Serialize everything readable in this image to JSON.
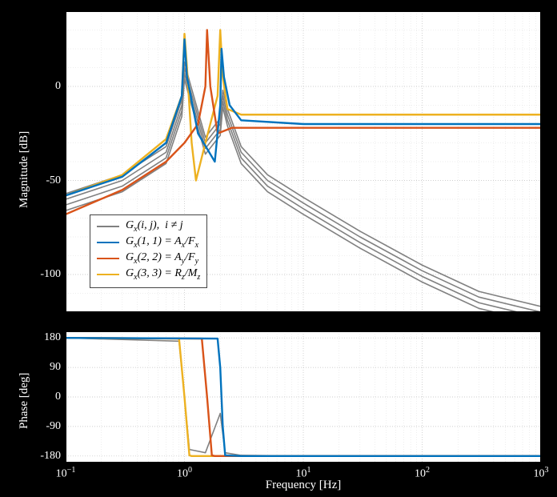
{
  "chart_data": [
    {
      "type": "line",
      "title": "",
      "xlabel": "",
      "ylabel": "Magnitude [dB]",
      "xscale": "log",
      "xlim": [
        0.1,
        1000
      ],
      "ylim": [
        -120,
        40
      ],
      "xticks": [
        0.1,
        1,
        10,
        100,
        1000
      ],
      "yticks": [
        -100,
        -50,
        0
      ],
      "grid": true,
      "legend_pos": "lower-left",
      "series": [
        {
          "name": "G_x(i,j), i≠j",
          "color": "#808080",
          "role": "off-diagonal"
        },
        {
          "name": "G_x(1,1) = A_x/F_x",
          "color": "#0072BD"
        },
        {
          "name": "G_x(2,2) = A_y/F_y",
          "color": "#D95319"
        },
        {
          "name": "G_x(3,3) = R_z/M_z",
          "color": "#EDB120"
        }
      ],
      "curves": {
        "grey_offdiag": {
          "color": "#808080",
          "note": "multiple off-diagonal terms, approximate envelope",
          "freq_hz": [
            0.1,
            0.3,
            0.7,
            0.95,
            1.0,
            1.1,
            1.5,
            2.0,
            2.1,
            2.3,
            3.0,
            5,
            10,
            30,
            100,
            300,
            1000
          ],
          "mag_db": [
            -60,
            -50,
            -35,
            -10,
            10,
            0,
            -30,
            -20,
            -5,
            -15,
            -35,
            -50,
            -62,
            -80,
            -98,
            -112,
            -120
          ]
        },
        "blue_11": {
          "color": "#0072BD",
          "freq_hz": [
            0.1,
            0.3,
            0.7,
            0.95,
            1.0,
            1.05,
            1.3,
            1.8,
            2.0,
            2.05,
            2.15,
            2.4,
            3.0,
            10,
            100,
            1000
          ],
          "mag_db": [
            -58,
            -48,
            -30,
            -5,
            25,
            5,
            -25,
            -40,
            -10,
            20,
            5,
            -10,
            -18,
            -20,
            -20,
            -20
          ]
        },
        "red_22": {
          "color": "#D95319",
          "freq_hz": [
            0.1,
            0.3,
            0.7,
            1.0,
            1.3,
            1.5,
            1.55,
            1.65,
            1.9,
            2.5,
            3.0,
            10,
            100,
            1000
          ],
          "mag_db": [
            -68,
            -55,
            -40,
            -30,
            -20,
            0,
            30,
            0,
            -25,
            -22,
            -22,
            -22,
            -22,
            -22
          ]
        },
        "yellow_33": {
          "color": "#EDB120",
          "freq_hz": [
            0.1,
            0.3,
            0.7,
            0.95,
            1.0,
            1.05,
            1.15,
            1.25,
            1.5,
            1.9,
            2.0,
            2.1,
            2.3,
            3.0,
            10,
            100,
            1000
          ],
          "mag_db": [
            -58,
            -47,
            -28,
            -5,
            28,
            10,
            -30,
            -50,
            -30,
            -5,
            30,
            5,
            -12,
            -15,
            -15,
            -15,
            -15
          ]
        }
      }
    },
    {
      "type": "line",
      "title": "",
      "xlabel": "Frequency [Hz]",
      "ylabel": "Phase [deg]",
      "xscale": "log",
      "xlim": [
        0.1,
        1000
      ],
      "ylim": [
        -200,
        200
      ],
      "xticks": [
        0.1,
        1,
        10,
        100,
        1000
      ],
      "yticks": [
        -180,
        -90,
        0,
        90,
        180
      ],
      "grid": true,
      "series_ref": "same as magnitude",
      "curves": {
        "grey_offdiag": {
          "color": "#808080",
          "freq_hz": [
            0.1,
            0.9,
            1.0,
            1.1,
            1.5,
            2.0,
            2.2,
            3,
            10,
            1000
          ],
          "phase_deg": [
            180,
            170,
            0,
            -160,
            -170,
            -50,
            -170,
            -178,
            -180,
            -180
          ]
        },
        "blue_11": {
          "color": "#0072BD",
          "freq_hz": [
            0.1,
            1.9,
            2.0,
            2.1,
            2.2,
            3,
            1000
          ],
          "phase_deg": [
            180,
            178,
            90,
            -90,
            -178,
            -180,
            -180
          ]
        },
        "red_22": {
          "color": "#D95319",
          "freq_hz": [
            0.1,
            1.4,
            1.55,
            1.7,
            1.8,
            3,
            1000
          ],
          "phase_deg": [
            180,
            178,
            0,
            -178,
            -180,
            -180,
            -180
          ]
        },
        "yellow_33": {
          "color": "#EDB120",
          "freq_hz": [
            0.1,
            0.9,
            1.0,
            1.1,
            1.15,
            1.9,
            2.0,
            2.1,
            2.2,
            3,
            1000
          ],
          "phase_deg": [
            180,
            178,
            0,
            -178,
            -180,
            -180,
            -180,
            -180,
            -180,
            -180,
            -180
          ]
        }
      }
    }
  ],
  "legend": {
    "items": [
      {
        "color": "#808080",
        "label_html": "G<sub>x</sub>(i, j),&nbsp; i ≠ j"
      },
      {
        "color": "#0072BD",
        "label_html": "G<sub>x</sub>(1, 1) = A<sub>x</sub>/F<sub>x</sub>"
      },
      {
        "color": "#D95319",
        "label_html": "G<sub>x</sub>(2, 2) = A<sub>y</sub>/F<sub>y</sub>"
      },
      {
        "color": "#EDB120",
        "label_html": "G<sub>x</sub>(3, 3) = R<sub>z</sub>/M<sub>z</sub>"
      }
    ]
  },
  "labels": {
    "mag_ylabel": "Magnitude [dB]",
    "phase_ylabel": "Phase [deg]",
    "xlabel": "Frequency [Hz]",
    "xtick_labels": [
      "10⁻¹",
      "10⁰",
      "10¹",
      "10²",
      "10³"
    ],
    "mag_ytick_labels": [
      "-100",
      "-50",
      "0"
    ],
    "phase_ytick_labels": [
      "-180",
      "-90",
      "0",
      "90",
      "180"
    ]
  },
  "colors": {
    "grey": "#808080",
    "blue": "#0072BD",
    "red": "#D95319",
    "yellow": "#EDB120"
  }
}
